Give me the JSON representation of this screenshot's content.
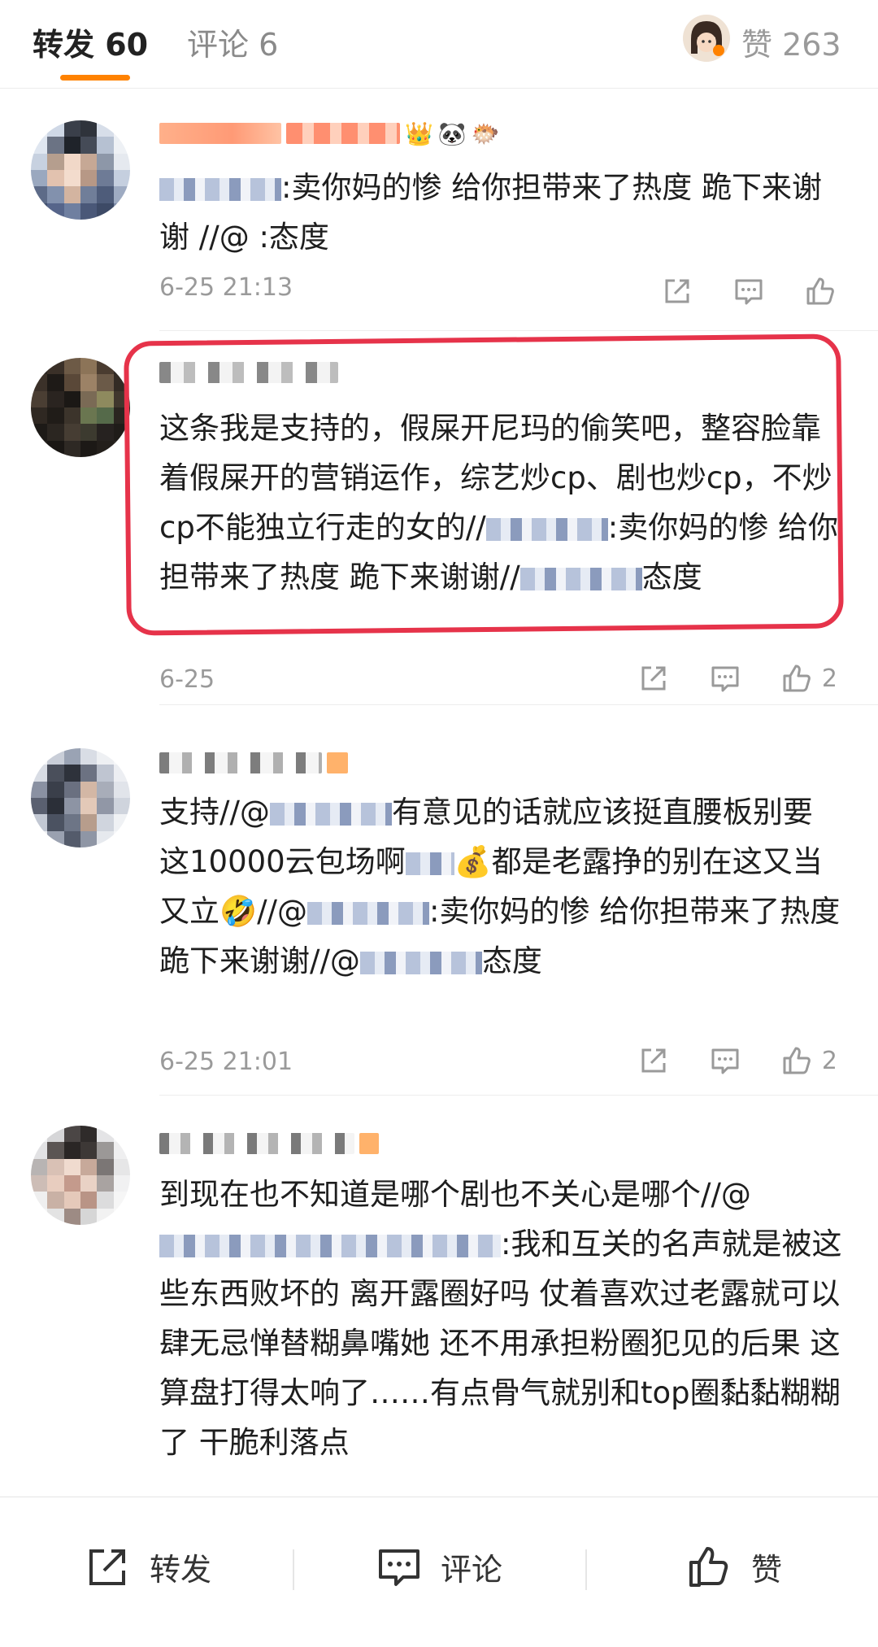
{
  "tabs": {
    "repost_label": "转发 60",
    "comment_label": "评论 6",
    "likes_label": "赞 263"
  },
  "comments": [
    {
      "text": ":卖你妈的惨 给你担带来了热度 跪下来谢谢 //@ :态度",
      "time": "6-25 21:13",
      "like_count": ""
    },
    {
      "text_parts": [
        "这条我是支持的，假屎开尼玛的偷笑吧，整容脸靠着假屎开的营销运作，综艺炒cp、剧也炒cp，不炒cp不能独立行走的女的//",
        ":卖你妈的惨 给你担带来了热度 跪下来谢谢//",
        "态度"
      ],
      "time": "6-25",
      "like_count": "2"
    },
    {
      "text_parts": [
        "支持//@",
        "有意见的话就应该挺直腰板别要这10000云包场啊",
        "💰都是老露挣的别在这又当又立🤣//@",
        ":卖你妈的惨 给你担带来了热度 跪下来谢谢//@",
        "态度"
      ],
      "time": "6-25 21:01",
      "like_count": "2"
    },
    {
      "text_parts": [
        "到现在也不知道是哪个剧也不关心是哪个//@",
        ":我和互关的名声就是被这些东西败坏的 离开露圈好吗 仗着喜欢过老露就可以肆无忌惮替糊鼻嘴她 还不用承担粉圈犯见的后果 这算盘打得太响了……有点骨气就别和top圈黏黏糊糊了 干脆利落点"
      ],
      "time": "",
      "like_count": ""
    }
  ],
  "bottom": {
    "repost": "转发",
    "comment": "评论",
    "like": "赞"
  },
  "colors": {
    "accent": "#ff8200",
    "highlight": "#e6334a",
    "mention_mask": "#8b9bbd"
  }
}
